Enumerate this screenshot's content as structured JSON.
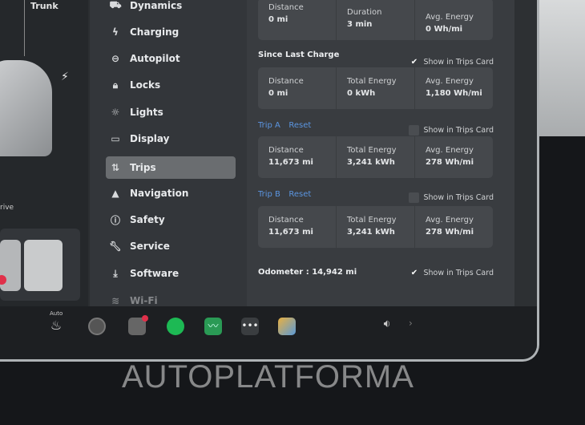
{
  "car_panel": {
    "trunk_label": "Trunk",
    "drive_label": "rive"
  },
  "menu": {
    "items": [
      {
        "label": "Dynamics",
        "icon": "car-icon"
      },
      {
        "label": "Charging",
        "icon": "bolt-icon"
      },
      {
        "label": "Autopilot",
        "icon": "steering-wheel-icon"
      },
      {
        "label": "Locks",
        "icon": "lock-icon"
      },
      {
        "label": "Lights",
        "icon": "sun-icon"
      },
      {
        "label": "Display",
        "icon": "display-icon"
      },
      {
        "label": "Trips",
        "icon": "trips-icon",
        "selected": true
      },
      {
        "label": "Navigation",
        "icon": "navigation-icon"
      },
      {
        "label": "Safety",
        "icon": "alert-circle-icon"
      },
      {
        "label": "Service",
        "icon": "wrench-icon"
      },
      {
        "label": "Software",
        "icon": "download-icon"
      },
      {
        "label": "Wi-Fi",
        "icon": "wifi-icon"
      }
    ]
  },
  "trips": {
    "current": {
      "c1": {
        "label": "Distance",
        "value": "0 mi"
      },
      "c2": {
        "label": "Duration",
        "value": "3 min"
      },
      "c3": {
        "label": "Avg. Energy",
        "value": "0 Wh/mi"
      }
    },
    "since_last_charge": {
      "title": "Since Last Charge",
      "show_label": "Show in Trips Card",
      "checked": true,
      "c1": {
        "label": "Distance",
        "value": "0 mi"
      },
      "c2": {
        "label": "Total Energy",
        "value": "0 kWh"
      },
      "c3": {
        "label": "Avg. Energy",
        "value": "1,180 Wh/mi"
      }
    },
    "trip_a": {
      "title": "Trip A",
      "reset": "Reset",
      "show_label": "Show in Trips Card",
      "checked": false,
      "c1": {
        "label": "Distance",
        "value": "11,673 mi"
      },
      "c2": {
        "label": "Total Energy",
        "value": "3,241 kWh"
      },
      "c3": {
        "label": "Avg. Energy",
        "value": "278 Wh/mi"
      }
    },
    "trip_b": {
      "title": "Trip B",
      "reset": "Reset",
      "show_label": "Show in Trips Card",
      "checked": false,
      "c1": {
        "label": "Distance",
        "value": "11,673 mi"
      },
      "c2": {
        "label": "Total Energy",
        "value": "3,241 kWh"
      },
      "c3": {
        "label": "Avg. Energy",
        "value": "278 Wh/mi"
      }
    },
    "odometer": {
      "label": "Odometer",
      "value": "14,942 mi",
      "show_label": "Show in Trips Card",
      "checked": true,
      "sep": ":"
    }
  },
  "taskbar": {
    "seat_heater_label": "Auto",
    "colors": {
      "spotify": "#1db954",
      "energy": "#2a9a55",
      "accent": "#5b95e0"
    }
  },
  "watermark": "AUTOPLATFORMA"
}
